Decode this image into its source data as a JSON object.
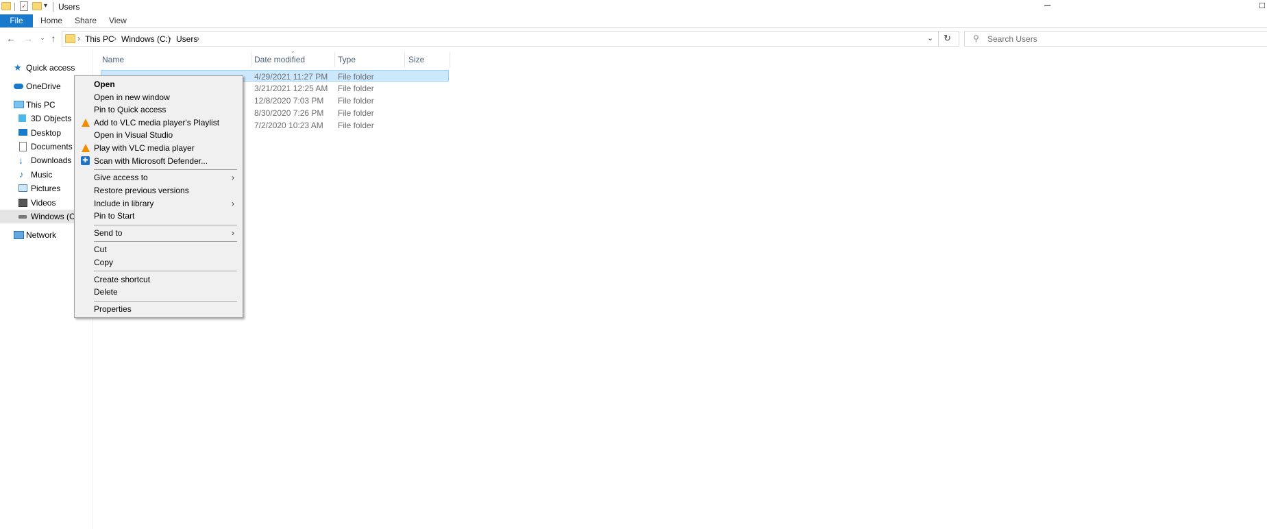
{
  "window": {
    "title": "Users",
    "minimize_glyph": "─",
    "maximize_glyph": "□"
  },
  "ribbon": {
    "tabs": [
      {
        "label": "File"
      },
      {
        "label": "Home"
      },
      {
        "label": "Share"
      },
      {
        "label": "View"
      }
    ]
  },
  "address": {
    "breadcrumbs": [
      "This PC",
      "Windows (C:)",
      "Users"
    ]
  },
  "search": {
    "placeholder": "Search Users"
  },
  "nav": {
    "items": [
      {
        "label": "Quick access",
        "icon": "star-icon"
      },
      {
        "label": "OneDrive",
        "icon": "cloud-icon"
      },
      {
        "label": "This PC",
        "icon": "computer-icon"
      },
      {
        "label": "3D Objects",
        "icon": "cube-icon"
      },
      {
        "label": "Desktop",
        "icon": "desktop-icon"
      },
      {
        "label": "Documents",
        "icon": "document-icon"
      },
      {
        "label": "Downloads",
        "icon": "download-icon"
      },
      {
        "label": "Music",
        "icon": "music-icon"
      },
      {
        "label": "Pictures",
        "icon": "picture-icon"
      },
      {
        "label": "Videos",
        "icon": "video-icon"
      },
      {
        "label": "Windows (C:)",
        "icon": "drive-icon",
        "selected": true
      },
      {
        "label": "Network",
        "icon": "network-icon"
      }
    ]
  },
  "columns": {
    "name": "Name",
    "date": "Date modified",
    "type": "Type",
    "size": "Size"
  },
  "files": [
    {
      "date": "4/29/2021 11:27 PM",
      "type": "File folder",
      "selected": true
    },
    {
      "date": "3/21/2021 12:25 AM",
      "type": "File folder"
    },
    {
      "date": "12/8/2020 7:03 PM",
      "type": "File folder"
    },
    {
      "date": "8/30/2020 7:26 PM",
      "type": "File folder"
    },
    {
      "date": "7/2/2020 10:23 AM",
      "type": "File folder"
    }
  ],
  "context_menu": {
    "open": "Open",
    "open_new_window": "Open in new window",
    "pin_quick_access": "Pin to Quick access",
    "add_vlc_playlist": "Add to VLC media player's Playlist",
    "open_visual_studio": "Open in Visual Studio",
    "play_vlc": "Play with VLC media player",
    "scan_defender": "Scan with Microsoft Defender...",
    "give_access": "Give access to",
    "restore_versions": "Restore previous versions",
    "include_library": "Include in library",
    "pin_start": "Pin to Start",
    "send_to": "Send to",
    "cut": "Cut",
    "copy": "Copy",
    "create_shortcut": "Create shortcut",
    "delete": "Delete",
    "properties": "Properties"
  },
  "colors": {
    "accent": "#1979ca",
    "selection": "#cce8ff",
    "menu_bg": "#f0f0f0"
  }
}
